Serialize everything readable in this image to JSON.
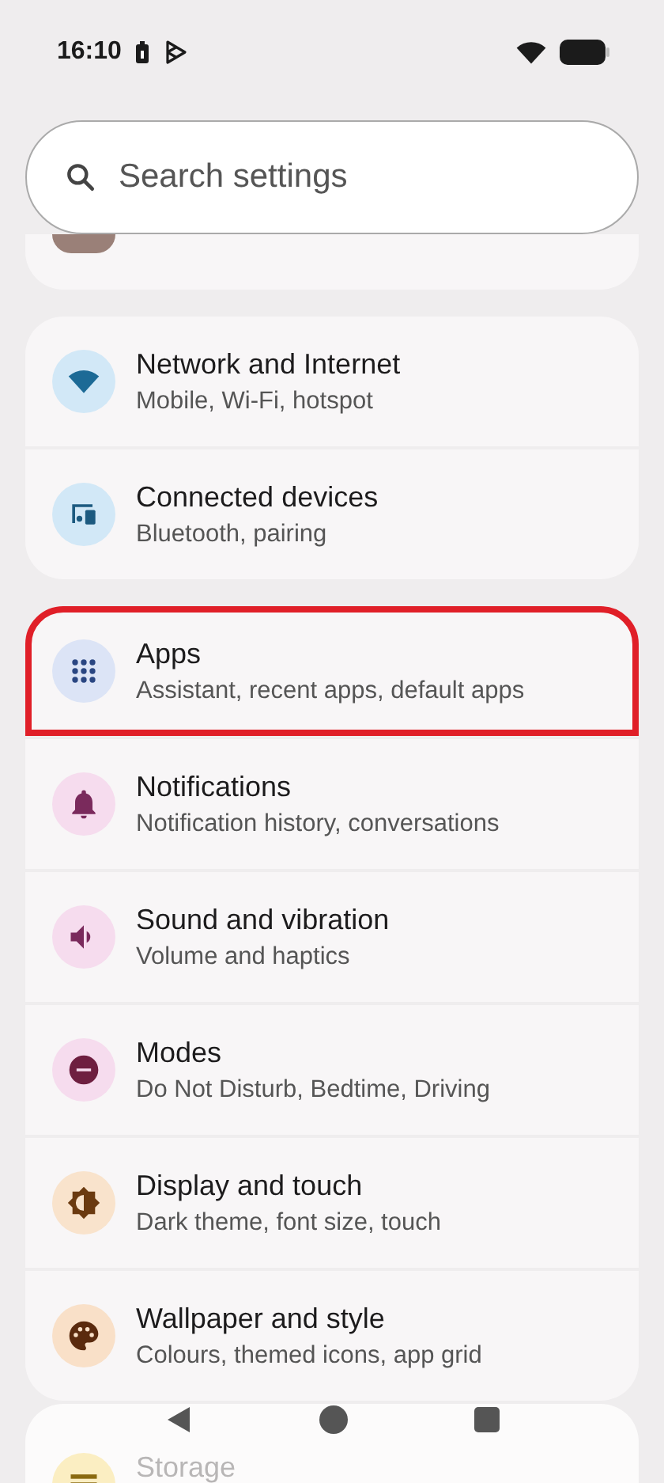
{
  "status_bar": {
    "time": "16:10"
  },
  "search": {
    "placeholder": "Search settings"
  },
  "groups": [
    {
      "items": [
        {
          "title": "Network and Internet",
          "subtitle": "Mobile, Wi-Fi, hotspot",
          "color": "#d2e8f7",
          "highlighted": false
        },
        {
          "title": "Connected devices",
          "subtitle": "Bluetooth, pairing",
          "color": "#d2e8f7",
          "highlighted": false
        }
      ]
    },
    {
      "items": [
        {
          "title": "Apps",
          "subtitle": "Assistant, recent apps, default apps",
          "color": "#dce4f6",
          "highlighted": true
        },
        {
          "title": "Notifications",
          "subtitle": "Notification history, conversations",
          "color": "#f6dcee",
          "highlighted": false
        },
        {
          "title": "Sound and vibration",
          "subtitle": "Volume and haptics",
          "color": "#f6dcee",
          "highlighted": false
        },
        {
          "title": "Modes",
          "subtitle": "Do Not Disturb, Bedtime, Driving",
          "color": "#f6dcee",
          "highlighted": false
        },
        {
          "title": "Display and touch",
          "subtitle": "Dark theme, font size, touch",
          "color": "#f9e3cc",
          "highlighted": false
        },
        {
          "title": "Wallpaper and style",
          "subtitle": "Colours, themed icons, app grid",
          "color": "#f9e0c8",
          "highlighted": false
        }
      ]
    },
    {
      "items": [
        {
          "title": "Storage",
          "color": "#fbeec2",
          "highlighted": false
        }
      ]
    }
  ]
}
